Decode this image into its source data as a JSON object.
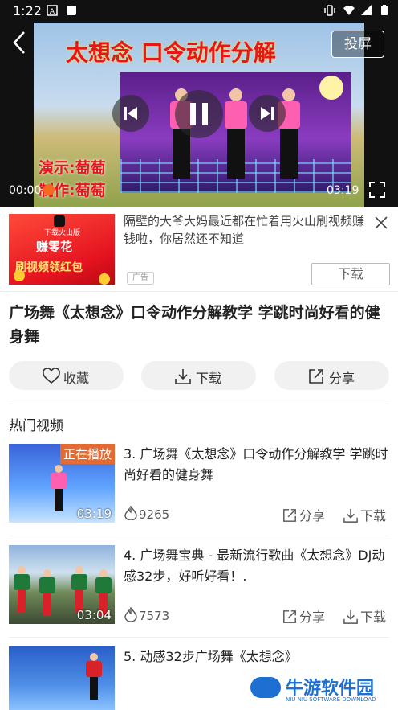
{
  "status_bar": {
    "time": "1:22"
  },
  "player": {
    "video_title_overlay": "太想念 口令动作分解",
    "credit_line1": "演示:萄萄",
    "credit_line2": "制作:萄萄",
    "cast_label": "投屏",
    "current_time": "00:00",
    "total_time": "03:19",
    "progress": 0.0
  },
  "ad": {
    "text": "隔壁的大爷大妈最近都在忙着用火山刷视频赚钱啦，你居然还不知道",
    "thumb_brand": "下载火山版",
    "thumb_line1": "赚零花",
    "thumb_line2": "刷视频领红包",
    "tag": "广告",
    "download_label": "下载"
  },
  "video": {
    "title": "广场舞《太想念》口令动作分解教学 学跳时尚好看的健身舞"
  },
  "actions": [
    {
      "label": "收藏",
      "icon": "heart-icon"
    },
    {
      "label": "下载",
      "icon": "download-icon"
    },
    {
      "label": "分享",
      "icon": "share-icon"
    }
  ],
  "section": {
    "label": "热门视频"
  },
  "list": [
    {
      "title": "3. 广场舞《太想念》口令动作分解教学 学跳时尚好看的健身舞",
      "duration": "03:19",
      "views": "9265",
      "playing_badge": "正在播放",
      "share": "分享",
      "download": "下载"
    },
    {
      "title": "4. 广场舞宝典 - 最新流行歌曲《太想念》DJ动感32步，好听好看！.",
      "duration": "03:04",
      "views": "7573",
      "share": "分享",
      "download": "下载"
    },
    {
      "title": "5. 动感32步广场舞《太想念》"
    }
  ],
  "watermark": {
    "name": "牛游软件园",
    "sub": "NIU NIU SOFTWARE DOWNLOAD"
  },
  "colors": {
    "accent": "#f56a1f",
    "brand_blue": "#1d6fd1",
    "ad_red": "#e4131f"
  }
}
